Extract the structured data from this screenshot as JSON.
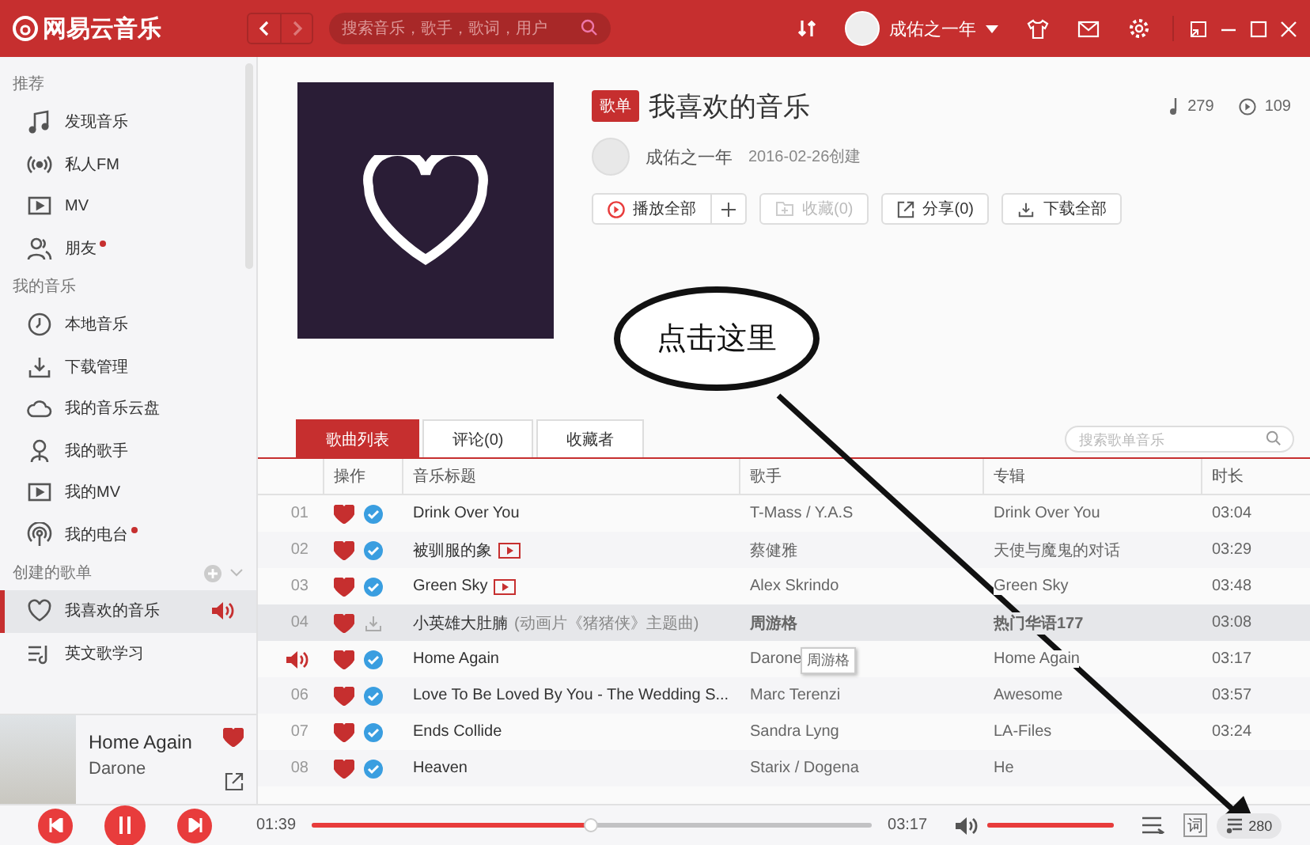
{
  "topbar": {
    "app_name": "网易云音乐",
    "search": {
      "placeholder": "搜索音乐，歌手，歌词，用户"
    },
    "user": "成佑之一年"
  },
  "sidebar": {
    "sections": [
      {
        "heading": "推荐",
        "items": [
          {
            "label": "发现音乐",
            "kind": "note",
            "selected": false,
            "dot": false
          },
          {
            "label": "私人FM",
            "kind": "radio",
            "selected": false,
            "dot": false
          },
          {
            "label": "MV",
            "kind": "video",
            "selected": false,
            "dot": false
          },
          {
            "label": "朋友",
            "kind": "people",
            "selected": false,
            "dot": true
          }
        ]
      },
      {
        "heading": "我的音乐",
        "items": [
          {
            "label": "本地音乐",
            "kind": "clock",
            "selected": false,
            "dot": false
          },
          {
            "label": "下载管理",
            "kind": "download",
            "selected": false,
            "dot": false
          },
          {
            "label": "我的音乐云盘",
            "kind": "cloud",
            "selected": false,
            "dot": false
          },
          {
            "label": "我的歌手",
            "kind": "person",
            "selected": false,
            "dot": false
          },
          {
            "label": "我的MV",
            "kind": "video",
            "selected": false,
            "dot": false
          },
          {
            "label": "我的电台",
            "kind": "podcast",
            "selected": false,
            "dot": true
          }
        ]
      },
      {
        "heading": "创建的歌单",
        "addable": true,
        "items": [
          {
            "label": "我喜欢的音乐",
            "kind": "heart",
            "selected": true,
            "dot": false,
            "playing": true
          },
          {
            "label": "英文歌学习",
            "kind": "list",
            "selected": false,
            "dot": false,
            "playing": false
          }
        ]
      }
    ],
    "now_playing": {
      "title": "Home Again",
      "artist": "Darone",
      "liked": true
    }
  },
  "playlist": {
    "badge": "歌单",
    "title": "我喜欢的音乐",
    "song_count": "279",
    "play_count": "109",
    "creator": "成佑之一年",
    "created": "2016-02-26创建",
    "actions": [
      {
        "label": "播放全部",
        "kind": "play",
        "disabled": false
      },
      {
        "label": "收藏(0)",
        "kind": "folder",
        "disabled": true
      },
      {
        "label": "分享(0)",
        "kind": "share",
        "disabled": false
      },
      {
        "label": "下载全部",
        "kind": "download",
        "disabled": false
      }
    ]
  },
  "tabs": [
    {
      "label": "歌曲列表",
      "selected": true
    },
    {
      "label": "评论(0)",
      "selected": false
    },
    {
      "label": "收藏者",
      "selected": false
    }
  ],
  "list_search": {
    "placeholder": "搜索歌单音乐"
  },
  "table": {
    "columns": [
      "操作",
      "音乐标题",
      "歌手",
      "专辑",
      "时长"
    ],
    "rows": [
      {
        "index": "01",
        "playing": false,
        "liked": true,
        "downloaded": true,
        "title": "Drink Over You",
        "mv": false,
        "artist": "T-Mass / Y.A.S",
        "album": "Drink Over You",
        "duration": "03:04",
        "selected": false
      },
      {
        "index": "02",
        "playing": false,
        "liked": true,
        "downloaded": true,
        "title": "被驯服的象",
        "mv": true,
        "artist": "蔡健雅",
        "album": "天使与魔鬼的对话",
        "duration": "03:29",
        "selected": false
      },
      {
        "index": "03",
        "playing": false,
        "liked": true,
        "downloaded": true,
        "title": "Green Sky",
        "mv": true,
        "artist": "Alex Skrindo",
        "album": "Green Sky",
        "duration": "03:48",
        "selected": false
      },
      {
        "index": "04",
        "playing": false,
        "liked": true,
        "downloaded": false,
        "title": "小英雄大肚腩",
        "subtitle": "(动画片《猪猪侠》主题曲)",
        "mv": false,
        "artist": "周游格",
        "album": "热门华语177",
        "duration": "03:08",
        "selected": true
      },
      {
        "playing": true,
        "liked": true,
        "downloaded": true,
        "title": "Home Again",
        "mv": false,
        "artist": "Darone",
        "album": "Home Again",
        "duration": "03:17",
        "selected": false,
        "tooltip": "周游格"
      },
      {
        "index": "06",
        "playing": false,
        "liked": true,
        "downloaded": true,
        "title": "Love To Be Loved By You - The Wedding S...",
        "mv": false,
        "artist": "Marc Terenzi",
        "album": "Awesome",
        "duration": "03:57",
        "selected": false
      },
      {
        "index": "07",
        "playing": false,
        "liked": true,
        "downloaded": true,
        "title": "Ends Collide",
        "mv": false,
        "artist": "Sandra Lyng",
        "album": "LA-Files",
        "duration": "03:24",
        "selected": false
      },
      {
        "index": "08",
        "playing": false,
        "liked": true,
        "downloaded": true,
        "title": "Heaven",
        "mv": false,
        "artist": "Starix / Dogena",
        "album": "He",
        "selected": false
      }
    ]
  },
  "player": {
    "elapsed": "01:39",
    "total": "03:17",
    "level": 0.5,
    "volume": {
      "level": 1
    },
    "lyrics_button": "词",
    "queue_count": "280",
    "playing": true
  },
  "annotation": {
    "text": "点击这里"
  }
}
